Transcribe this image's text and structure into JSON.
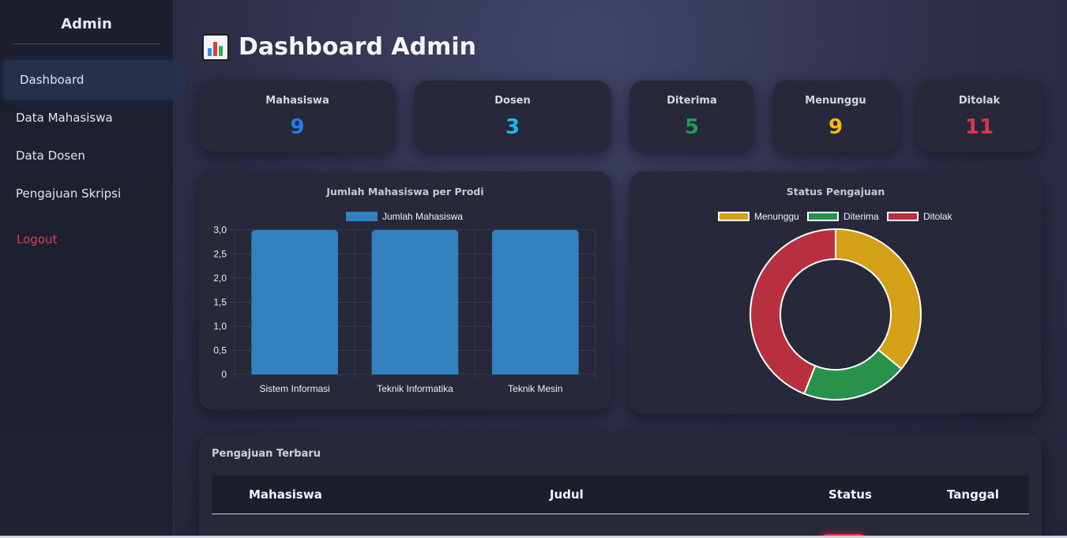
{
  "sidebar": {
    "title": "Admin",
    "items": [
      {
        "label": "Dashboard",
        "active": true
      },
      {
        "label": "Data Mahasiswa"
      },
      {
        "label": "Data Dosen"
      },
      {
        "label": "Pengajuan Skripsi"
      }
    ],
    "logout": "Logout"
  },
  "header": {
    "title": "Dashboard Admin",
    "icon": "bar-chart-icon"
  },
  "stats": [
    {
      "label": "Mahasiswa",
      "value": "9",
      "color": "#1f7cf2"
    },
    {
      "label": "Dosen",
      "value": "3",
      "color": "#1ab8f0"
    },
    {
      "label": "Diterima",
      "value": "5",
      "color": "#1f9b55"
    },
    {
      "label": "Menunggu",
      "value": "9",
      "color": "#f2b81a"
    },
    {
      "label": "Ditolak",
      "value": "11",
      "color": "#dc3545"
    }
  ],
  "charts": {
    "bar_title": "Jumlah Mahasiswa per Prodi",
    "donut_title": "Status Pengajuan"
  },
  "chart_data": [
    {
      "type": "bar",
      "title": "Jumlah Mahasiswa per Prodi",
      "categories": [
        "Sistem Informasi",
        "Teknik Informatika",
        "Teknik Mesin"
      ],
      "series": [
        {
          "name": "Jumlah Mahasiswa",
          "values": [
            3,
            3,
            3
          ],
          "color": "#3381be"
        }
      ],
      "ylim": [
        0,
        3
      ],
      "yticks": [
        "3,0",
        "2,5",
        "2,0",
        "1,5",
        "1,0",
        "0,5",
        "0"
      ],
      "grid": true,
      "legend": "top"
    },
    {
      "type": "pie",
      "title": "Status Pengajuan",
      "categories": [
        "Menunggu",
        "Diterima",
        "Ditolak"
      ],
      "values": [
        9,
        5,
        11
      ],
      "colors": [
        "#d4a017",
        "#28924a",
        "#b8303f"
      ],
      "legend": "top"
    }
  ],
  "table": {
    "title": "Pengajuan Terbaru",
    "columns": [
      "Mahasiswa",
      "Judul",
      "Status",
      "Tanggal"
    ]
  }
}
